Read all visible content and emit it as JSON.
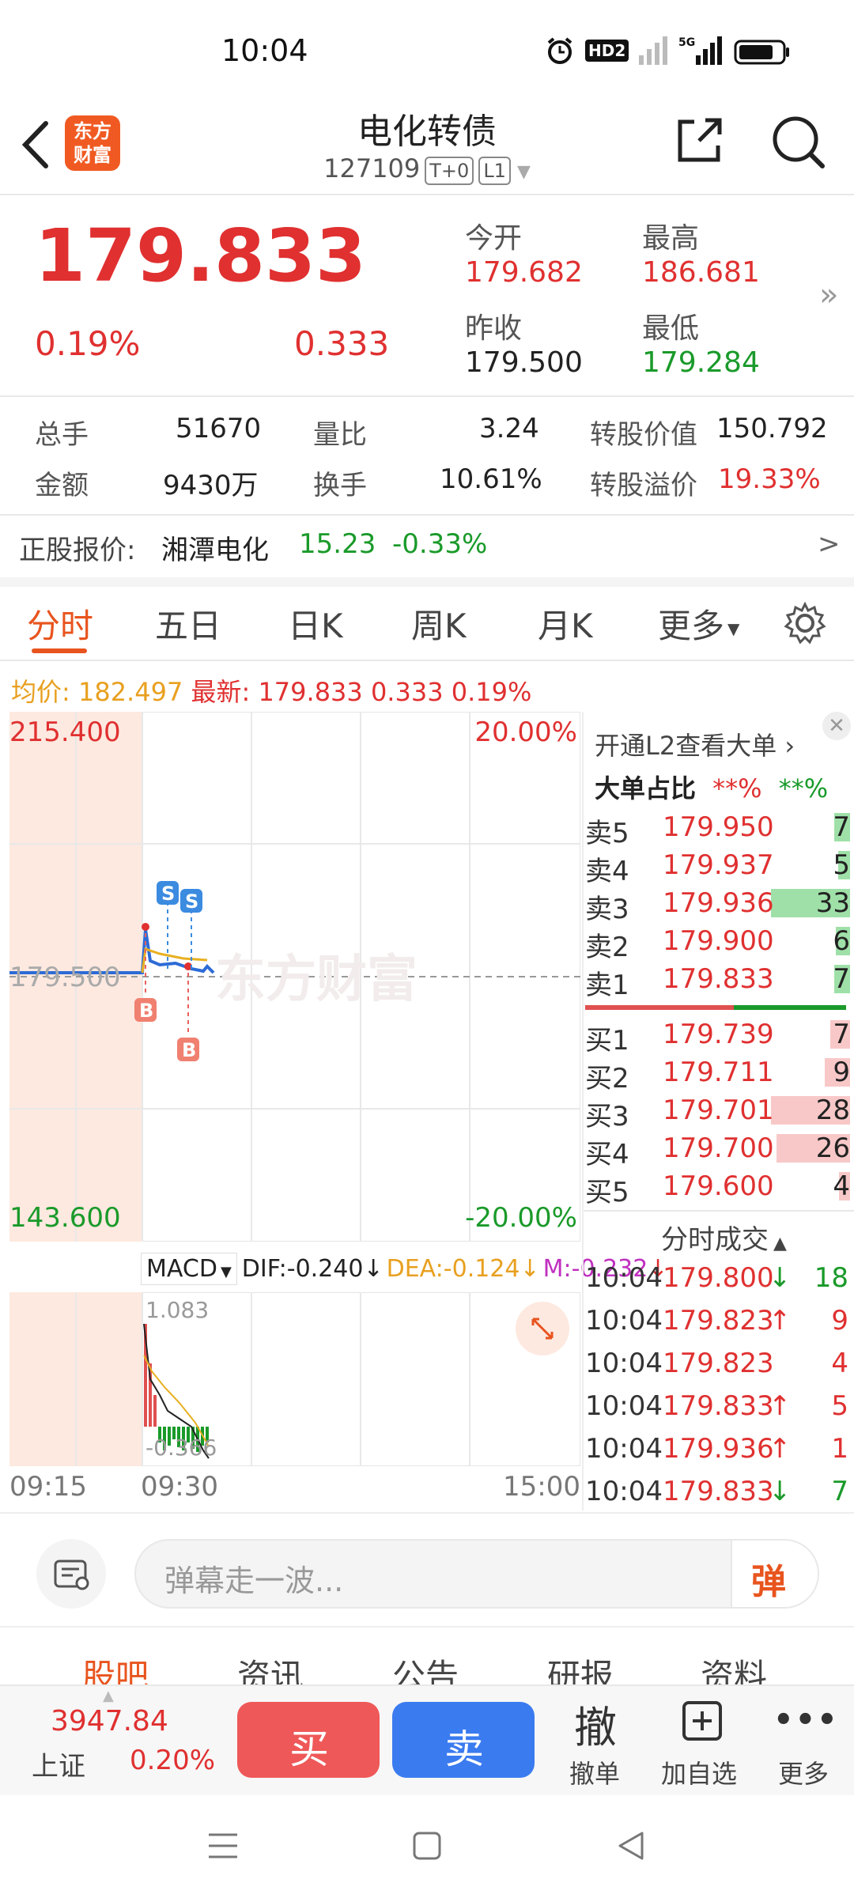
{
  "status_bar": {
    "time": "10:04",
    "hd_label": "HD2",
    "network": "5G"
  },
  "header": {
    "title": "电化转债",
    "code": "127109",
    "tags": [
      "T+0",
      "L1"
    ],
    "logo_text": "东方财富"
  },
  "quote": {
    "price": "179.833",
    "pct": "0.19%",
    "change": "0.333",
    "open_label": "今开",
    "open": "179.682",
    "high_label": "最高",
    "high": "186.681",
    "prev_close_label": "昨收",
    "prev_close": "179.500",
    "low_label": "最低",
    "low": "179.284"
  },
  "stats": {
    "vol_label": "总手",
    "vol": "51670",
    "ratio_label": "量比",
    "ratio": "3.24",
    "conv_value_label": "转股价值",
    "conv_value": "150.792",
    "amount_label": "金额",
    "amount": "9430万",
    "turnover_label": "换手",
    "turnover": "10.61%",
    "premium_label": "转股溢价",
    "premium": "19.33%"
  },
  "underlying": {
    "label": "正股报价:",
    "name": "湘潭电化",
    "price": "15.23",
    "pct": "-0.33%",
    "arrow": ">"
  },
  "tabs": [
    "分时",
    "五日",
    "日K",
    "周K",
    "月K",
    "更多"
  ],
  "active_tab": "分时",
  "info_line": {
    "avg_label": "均价:",
    "avg": "182.497",
    "last_label": "最新:",
    "last": "179.833",
    "change": "0.333",
    "pct": "0.19%"
  },
  "chart": {
    "y_top": "215.400",
    "y_bottom": "143.600",
    "ref": "179.500",
    "pct_top": "20.00%",
    "pct_bottom": "-20.00%",
    "watermark": "东方财富",
    "marks": [
      "S",
      "S",
      "B",
      "B"
    ],
    "macd_label": "MACD",
    "dif": "DIF:-0.240",
    "dea": "DEA:-0.124",
    "m": "M:-0.232",
    "macd_top": "1.083",
    "macd_bottom": "-0.366",
    "x_labels": [
      "09:15",
      "09:30",
      "15:00"
    ]
  },
  "orderbook": {
    "promo": "开通L2查看大单",
    "big_label": "大单占比",
    "big_red": "**%",
    "big_green": "**%",
    "asks": [
      {
        "label": "卖5",
        "price": "179.950",
        "vol": "7",
        "bar": 0.2
      },
      {
        "label": "卖4",
        "price": "179.937",
        "vol": "5",
        "bar": 0.15
      },
      {
        "label": "卖3",
        "price": "179.936",
        "vol": "33",
        "bar": 1.0
      },
      {
        "label": "卖2",
        "price": "179.900",
        "vol": "6",
        "bar": 0.18
      },
      {
        "label": "卖1",
        "price": "179.833",
        "vol": "7",
        "bar": 0.2
      }
    ],
    "bids": [
      {
        "label": "买1",
        "price": "179.739",
        "vol": "7",
        "bar": 0.25
      },
      {
        "label": "买2",
        "price": "179.711",
        "vol": "9",
        "bar": 0.32
      },
      {
        "label": "买3",
        "price": "179.701",
        "vol": "28",
        "bar": 1.0
      },
      {
        "label": "买4",
        "price": "179.700",
        "vol": "26",
        "bar": 0.93
      },
      {
        "label": "买5",
        "price": "179.600",
        "vol": "4",
        "bar": 0.14
      }
    ],
    "trades_title": "分时成交",
    "trades": [
      {
        "time": "10:04",
        "price": "179.800",
        "dir": "↓",
        "vol": "18",
        "color": "red",
        "vcolor": "green"
      },
      {
        "time": "10:04",
        "price": "179.823",
        "dir": "↑",
        "vol": "9",
        "color": "red",
        "vcolor": "red"
      },
      {
        "time": "10:04",
        "price": "179.823",
        "dir": "",
        "vol": "4",
        "color": "red",
        "vcolor": "red"
      },
      {
        "time": "10:04",
        "price": "179.833",
        "dir": "↑",
        "vol": "5",
        "color": "red",
        "vcolor": "red"
      },
      {
        "time": "10:04",
        "price": "179.936",
        "dir": "↑",
        "vol": "1",
        "color": "red",
        "vcolor": "red"
      },
      {
        "time": "10:04",
        "price": "179.833",
        "dir": "↓",
        "vol": "7",
        "color": "red",
        "vcolor": "green"
      }
    ]
  },
  "comment": {
    "placeholder": "弹幕走一波...",
    "danmu": "弹"
  },
  "bottom_tabs": [
    "股吧",
    "资讯",
    "公告",
    "研报",
    "资料"
  ],
  "toolbar": {
    "index_value": "3947.84",
    "index_name": "上证",
    "index_pct": "0.20%",
    "buy": "买",
    "sell": "卖",
    "cancel_icon": "撤",
    "cancel": "撤单",
    "watch": "加自选",
    "more": "更多"
  },
  "colors": {
    "red": "#e03030",
    "green": "#1a9a2a",
    "accent": "#e8541e",
    "blue": "#3b7bf0"
  }
}
